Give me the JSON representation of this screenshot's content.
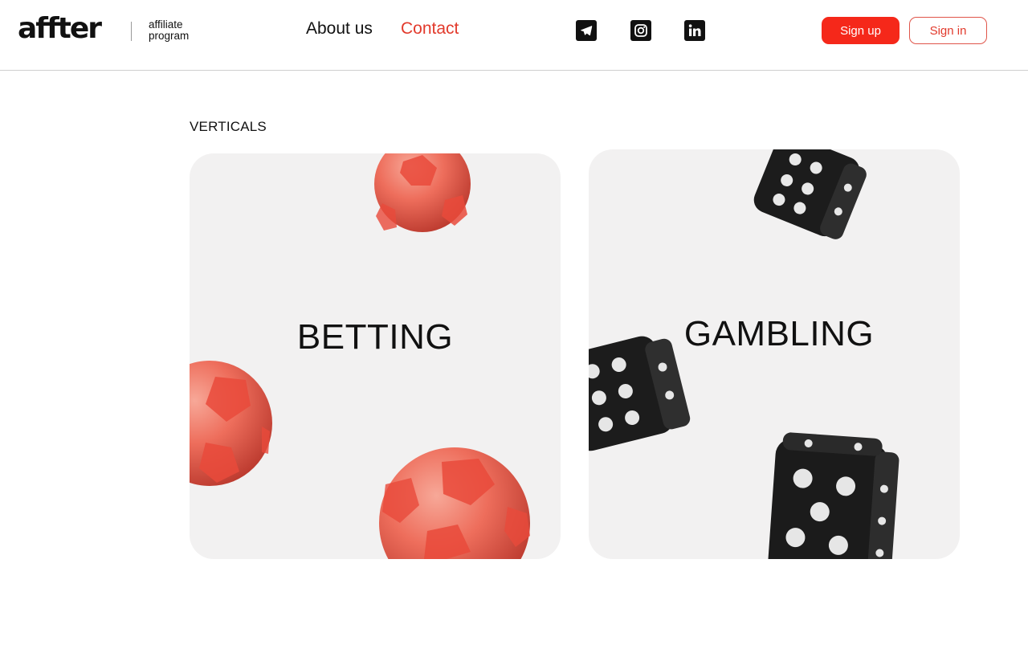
{
  "header": {
    "logo_text": "affter",
    "tagline_line1": "affiliate",
    "tagline_line2": "program",
    "nav": {
      "about": "About us",
      "contact": "Contact"
    },
    "social_icons": [
      "telegram-icon",
      "instagram-icon",
      "linkedin-icon"
    ],
    "buttons": {
      "signup": "Sign up",
      "signin": "Sign in"
    }
  },
  "main": {
    "section_label": "VERTICALS",
    "cards": [
      {
        "title": "BETTING",
        "decoration": "soccer-balls"
      },
      {
        "title": "GAMBLING",
        "decoration": "dice"
      }
    ]
  },
  "colors": {
    "accent": "#f5281a",
    "accent_text": "#e23a2c",
    "card_background": "#f2f1f1",
    "text": "#111111"
  }
}
